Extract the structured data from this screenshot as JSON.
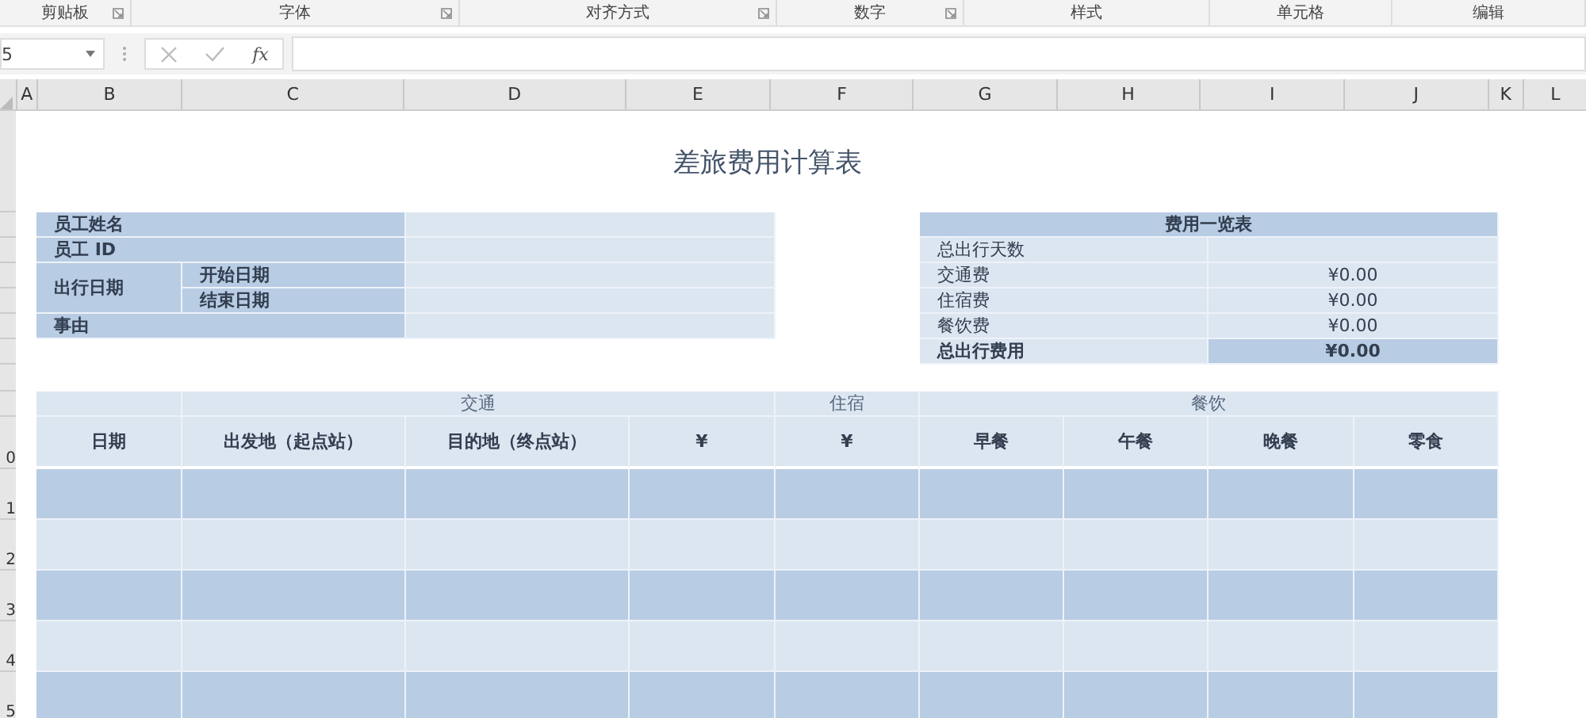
{
  "ribbon_groups": [
    {
      "label": "剪贴板",
      "launcher": true
    },
    {
      "label": "字体",
      "launcher": true
    },
    {
      "label": "对齐方式",
      "launcher": true
    },
    {
      "label": "数字",
      "launcher": true
    },
    {
      "label": "样式",
      "launcher": false
    },
    {
      "label": "单元格",
      "launcher": false
    },
    {
      "label": "编辑",
      "launcher": false
    }
  ],
  "formula_bar": {
    "name_box": "5",
    "fx": "fx"
  },
  "column_headers": [
    "A",
    "B",
    "C",
    "D",
    "E",
    "F",
    "G",
    "H",
    "I",
    "J",
    "K",
    "L"
  ],
  "row_numbers": [
    "0",
    "1",
    "2",
    "3",
    "4",
    "5"
  ],
  "title": "差旅费用计算表",
  "employee_info": {
    "name_label": "员工姓名",
    "id_label": "员工 ID",
    "travel_date_label": "出行日期",
    "start_date_label": "开始日期",
    "end_date_label": "结束日期",
    "reason_label": "事由"
  },
  "summary": {
    "title": "费用一览表",
    "rows": [
      {
        "label": "总出行天数",
        "value": "",
        "total": false
      },
      {
        "label": "交通费",
        "value": "¥0.00",
        "total": false
      },
      {
        "label": "住宿费",
        "value": "¥0.00",
        "total": false
      },
      {
        "label": "餐饮费",
        "value": "¥0.00",
        "total": false
      },
      {
        "label": "总出行费用",
        "value": "¥0.00",
        "total": true
      }
    ]
  },
  "expense_table": {
    "groups": [
      {
        "label": "交通"
      },
      {
        "label": "住宿"
      },
      {
        "label": "餐饮"
      }
    ],
    "columns": [
      "日期",
      "出发地（起点站）",
      "目的地（终点站）",
      "¥",
      "¥",
      "早餐",
      "午餐",
      "晚餐",
      "零食"
    ]
  }
}
